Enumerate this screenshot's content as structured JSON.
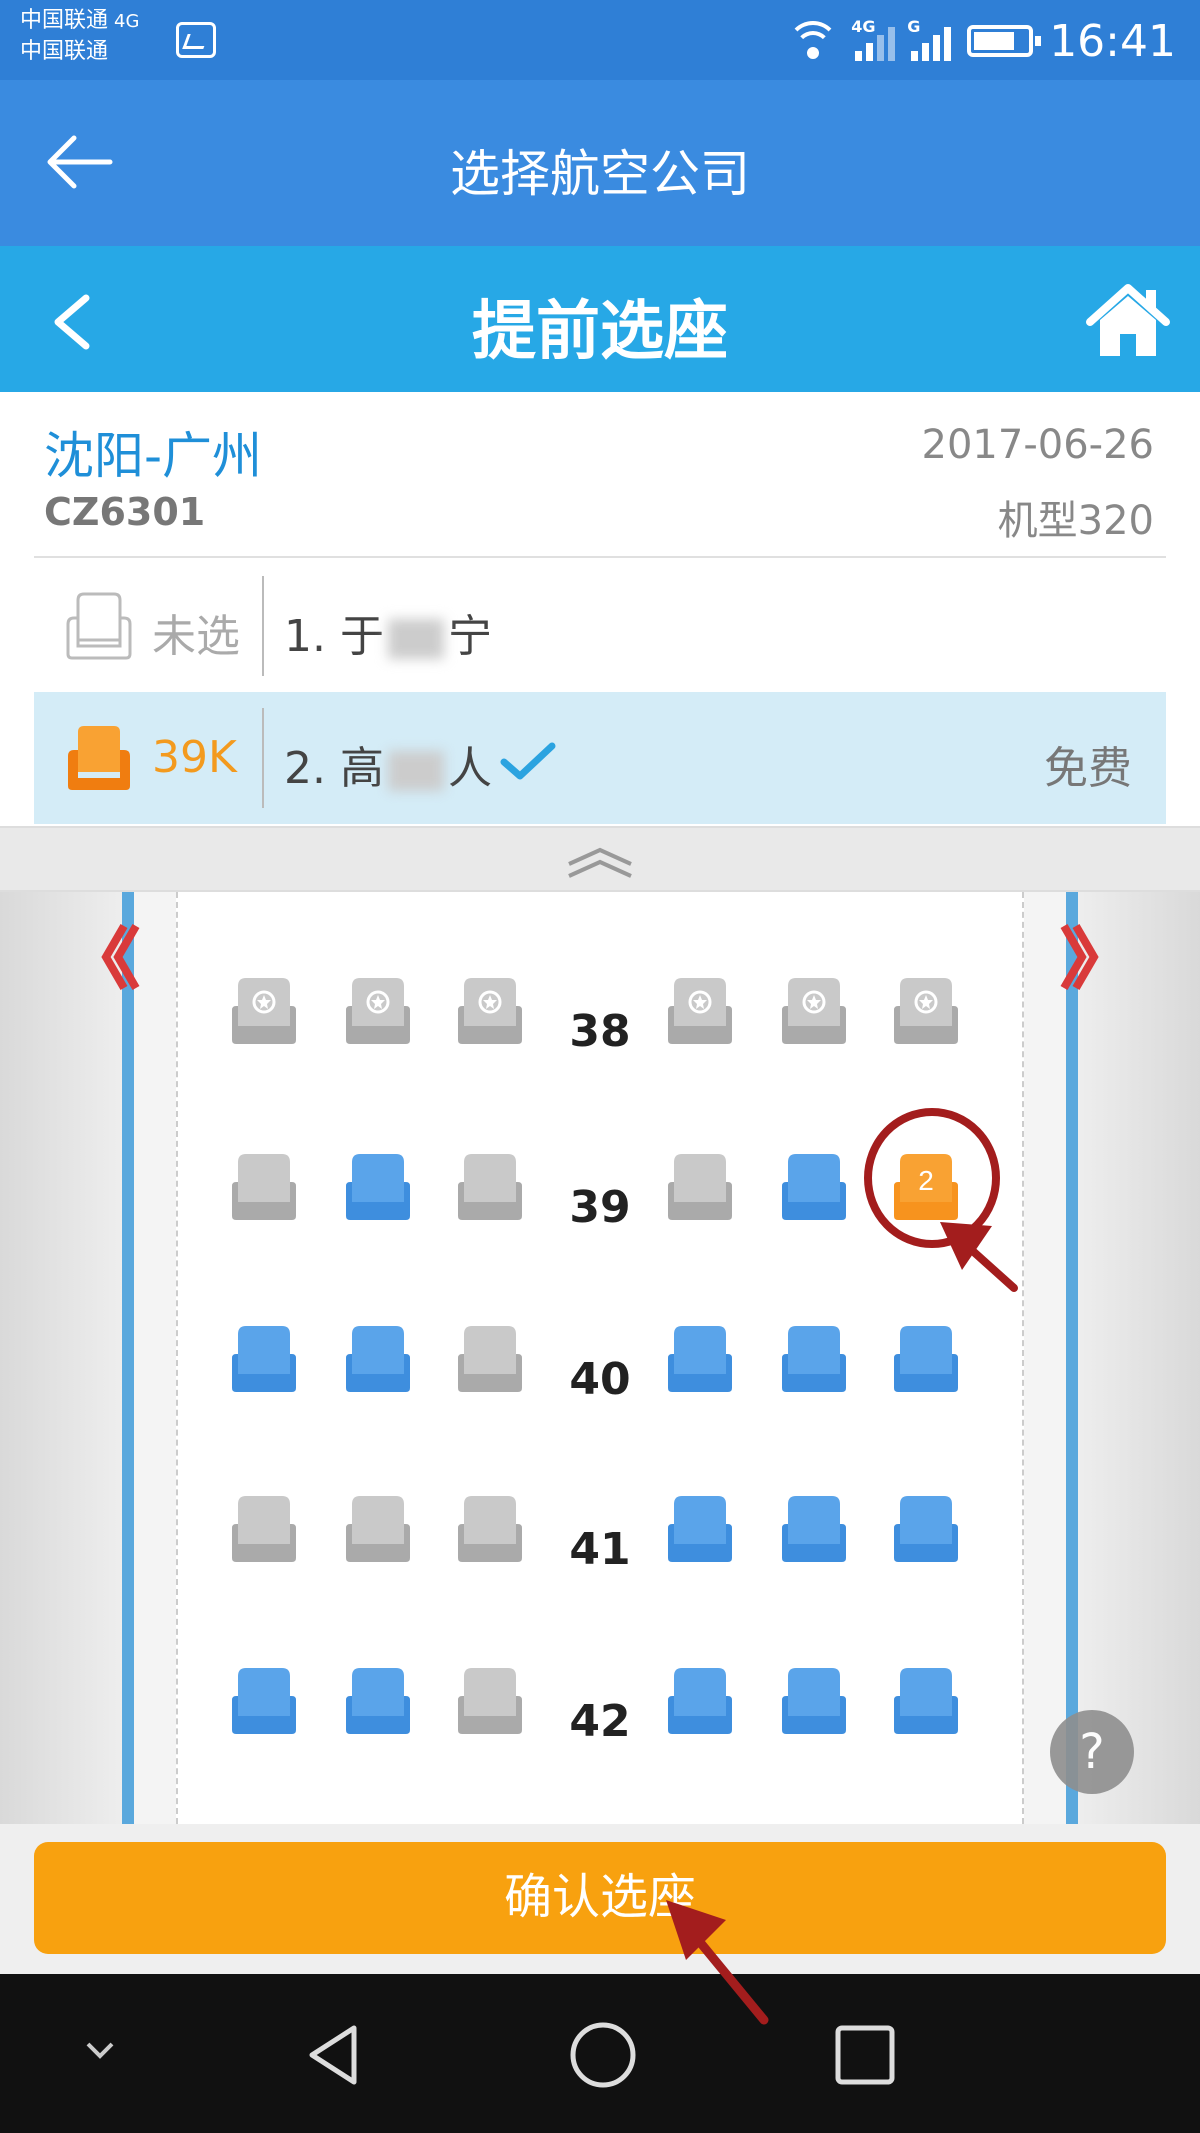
{
  "status_bar": {
    "carrier1": "中国联通",
    "carrier1_net": "4G",
    "carrier2": "中国联通",
    "sim1_label": "4G",
    "sim2_label": "G",
    "time": "16:41"
  },
  "app_header": {
    "title": "选择航空公司"
  },
  "page_header": {
    "title": "提前选座"
  },
  "flight": {
    "route": "沈阳-广州",
    "flight_no": "CZ6301",
    "date": "2017-06-26",
    "aircraft": "机型320"
  },
  "passengers": [
    {
      "seat_label": "未选",
      "name_prefix": "1. 于",
      "name_suffix": "宁",
      "fee": ""
    },
    {
      "seat_label": "39K",
      "name_prefix": "2. 高",
      "name_suffix": "人",
      "fee": "免费"
    }
  ],
  "cabin": {
    "rows": [
      {
        "number": "38",
        "seats": [
          "premium",
          "premium",
          "premium",
          "premium",
          "premium",
          "premium"
        ]
      },
      {
        "number": "39",
        "seats": [
          "occupied",
          "available",
          "occupied",
          "occupied",
          "available",
          "selected"
        ]
      },
      {
        "number": "40",
        "seats": [
          "available",
          "available",
          "occupied",
          "available",
          "available",
          "available"
        ]
      },
      {
        "number": "41",
        "seats": [
          "occupied",
          "occupied",
          "occupied",
          "available",
          "available",
          "available"
        ]
      },
      {
        "number": "42",
        "seats": [
          "available",
          "available",
          "occupied",
          "available",
          "available",
          "available"
        ]
      }
    ],
    "selected_seat_marker": "2",
    "help_label": "?"
  },
  "confirm_button": {
    "label": "确认选座"
  },
  "colors": {
    "available": "#5aa4ea",
    "occupied": "#c9c9c9",
    "selected": "#f7931e",
    "header_blue": "#27a8e6",
    "confirm": "#f8a10f"
  }
}
